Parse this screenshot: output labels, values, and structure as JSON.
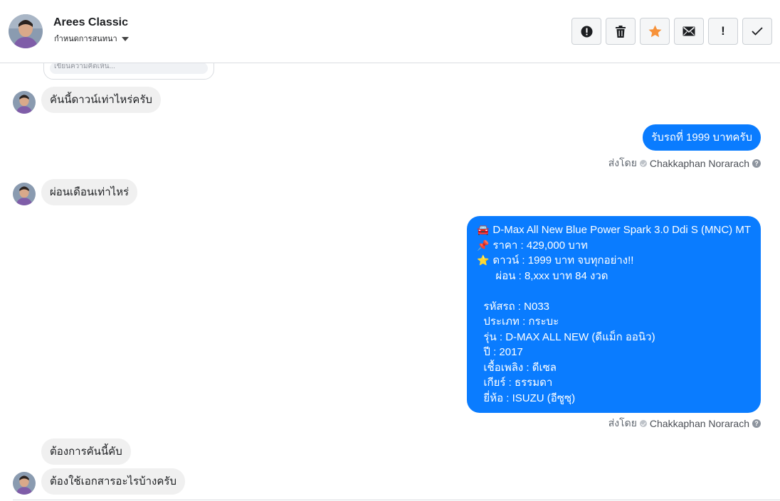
{
  "header": {
    "name": "Arees Classic",
    "subtitle": "กำหนดการสนทนา"
  },
  "actions": [
    {
      "icon": "alert-circle-icon",
      "label": ""
    },
    {
      "icon": "trash-icon",
      "label": ""
    },
    {
      "icon": "star-icon",
      "label": ""
    },
    {
      "icon": "envelope-icon",
      "label": ""
    },
    {
      "icon": "exclamation-icon",
      "label": "!"
    },
    {
      "icon": "checkmark-icon",
      "label": ""
    }
  ],
  "comment_box": {
    "placeholder": "เขียนความคิดเห็น..."
  },
  "messages": {
    "m1": {
      "text": "คันนี้ดาวน์เท่าไหร่ครับ"
    },
    "m2": {
      "text": "รับรถที่ 1999 บาทครับ"
    },
    "m2_sent": {
      "prefix": "ส่งโดย",
      "name": "Chakkaphan Norarach"
    },
    "m3": {
      "text": "ผ่อนเดือนเท่าไหร่"
    },
    "m4": {
      "lines": [
        {
          "emoji": "🚘",
          "text": "D-Max All New Blue Power Spark 3.0 Ddi S (MNC) MT"
        },
        {
          "emoji": "📌",
          "text": "ราคา : 429,000 บาท"
        },
        {
          "emoji": "⭐",
          "text": "ดาวน์ : 1999 บาท จบทุกอย่าง!!"
        },
        {
          "emoji": "",
          "text": "ผ่อน : 8,xxx บาท 84 งวด"
        },
        {
          "emoji": "",
          "text": ""
        },
        {
          "emoji": "",
          "text": "รหัสรถ : N033"
        },
        {
          "emoji": "",
          "text": "ประเภท : กระบะ"
        },
        {
          "emoji": "",
          "text": "รุ่น : D-MAX ALL NEW (ดีแม็ก ออนิว)"
        },
        {
          "emoji": "",
          "text": "ปี : 2017"
        },
        {
          "emoji": "",
          "text": "เชื้อเพลิง : ดีเซล"
        },
        {
          "emoji": "",
          "text": "เกียร์ : ธรรมดา"
        },
        {
          "emoji": "",
          "text": "ยี่ห้อ : ISUZU (อีซูซุ)"
        }
      ]
    },
    "m4_sent": {
      "prefix": "ส่งโดย",
      "name": "Chakkaphan Norarach"
    },
    "m5": {
      "text": "ต้องการคันนี้คับ"
    },
    "m6": {
      "text": "ต้องใช้เอกสารอะไรบ้างครับ"
    }
  },
  "colors": {
    "outgoing": "#0a7cff",
    "incoming": "#f0f0f0",
    "star": "#f7923a"
  }
}
